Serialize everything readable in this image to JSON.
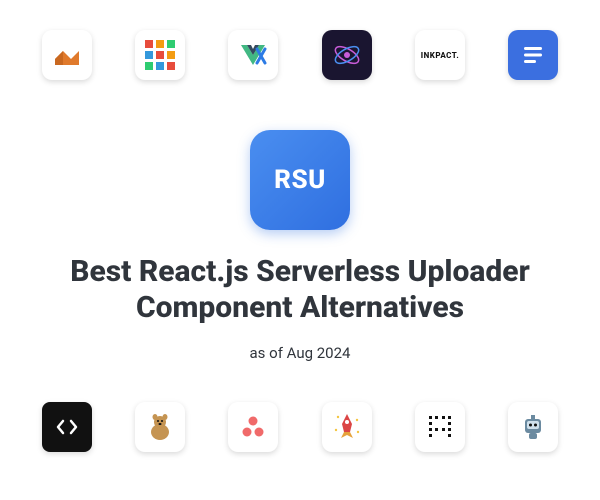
{
  "hero": {
    "badge_text": "RSU",
    "heading": "Best React.js Serverless Uploader Component Alternatives",
    "subheading": "as of Aug 2024"
  },
  "top_icons": [
    {
      "name": "immer-icon"
    },
    {
      "name": "grid-app-icon"
    },
    {
      "name": "vue-app-icon"
    },
    {
      "name": "preact-icon"
    },
    {
      "name": "inkpact-icon",
      "label": "INKPACT."
    },
    {
      "name": "lines-app-icon"
    }
  ],
  "bottom_icons": [
    {
      "name": "code-icon"
    },
    {
      "name": "animal-icon"
    },
    {
      "name": "asana-dots-icon"
    },
    {
      "name": "rocket-icon"
    },
    {
      "name": "letter-a-icon"
    },
    {
      "name": "robot-icon"
    }
  ]
}
